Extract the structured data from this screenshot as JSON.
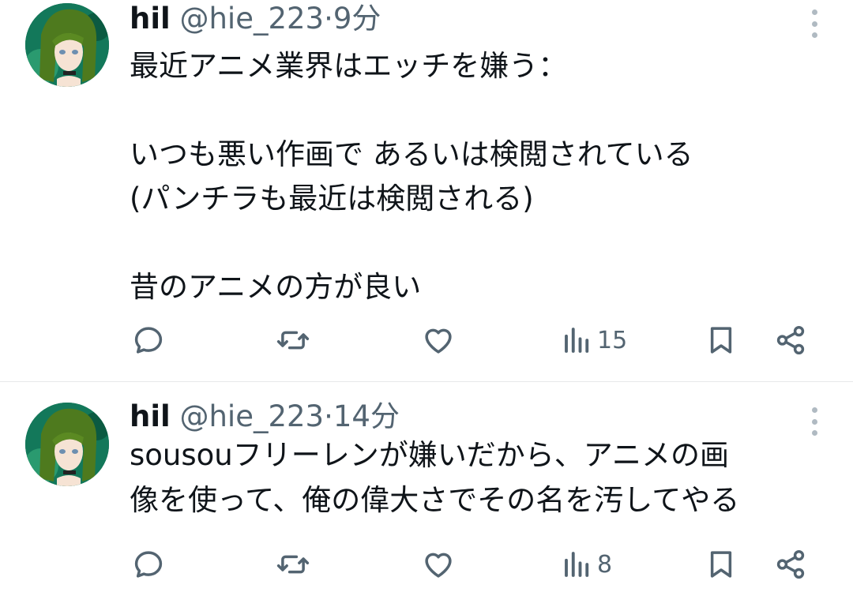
{
  "tweets": [
    {
      "name": "hil",
      "handle": "@hie_223",
      "sep": "·",
      "time": "9分",
      "lines": [
        "最近アニメ業界はエッチを嫌う：",
        "",
        "いつも悪い作画で あるいは検閲されている",
        "(パンチラも最近は検閲される)",
        "",
        "昔のアニメの方が良い"
      ],
      "views": "15"
    },
    {
      "name": "hil",
      "handle": "@hie_223",
      "sep": "·",
      "time": "14分",
      "lines": [
        "sousouフリーレンが嫌いだから、アニメの画",
        "像を使って、俺の偉大さでその名を汚してやる"
      ],
      "views": "8"
    }
  ],
  "icons": {
    "reply": "reply-icon",
    "retweet": "retweet-icon",
    "like": "heart-icon",
    "views": "views-chart-icon",
    "bookmark": "bookmark-icon",
    "share": "share-icon",
    "more": "more-vertical-icon"
  },
  "colors": {
    "text": "#0f1419",
    "secondary": "#536471",
    "divider": "#e7e9ea"
  }
}
